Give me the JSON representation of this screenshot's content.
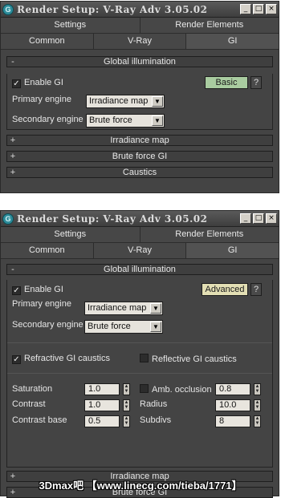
{
  "top": {
    "title": "Render Setup: V-Ray Adv 3.05.02",
    "tabs_row1": [
      "Settings",
      "Render Elements"
    ],
    "tabs_row2": [
      "Common",
      "V-Ray",
      "GI"
    ],
    "global_title": "Global illumination",
    "collapse_sign": "-",
    "enable_gi": "Enable GI",
    "mode_button": "Basic",
    "help": "?",
    "primary_label": "Primary engine",
    "primary_value": "Irradiance map",
    "secondary_label": "Secondary engine",
    "secondary_value": "Brute force",
    "rollouts": [
      "Irradiance map",
      "Brute force GI",
      "Caustics"
    ]
  },
  "bottom": {
    "title": "Render Setup: V-Ray Adv 3.05.02",
    "tabs_row1": [
      "Settings",
      "Render Elements"
    ],
    "tabs_row2": [
      "Common",
      "V-Ray",
      "GI"
    ],
    "global_title": "Global illumination",
    "collapse_sign": "-",
    "enable_gi": "Enable GI",
    "mode_button": "Advanced",
    "help": "?",
    "primary_label": "Primary engine",
    "primary_value": "Irradiance map",
    "secondary_label": "Secondary engine",
    "secondary_value": "Brute force",
    "refractive": "Refractive GI caustics",
    "reflective": "Reflective GI caustics",
    "saturation_label": "Saturation",
    "saturation": "1.0",
    "contrast_label": "Contrast",
    "contrast": "1.0",
    "contrast_base_label": "Contrast base",
    "contrast_base": "0.5",
    "amb_label": "Amb. occlusion",
    "amb": "0.8",
    "radius_label": "Radius",
    "radius": "10.0",
    "subdivs_label": "Subdivs",
    "subdivs": "8",
    "rollouts": [
      "Irradiance map",
      "Brute force GI"
    ]
  },
  "watermark": "3Dmax吧 【www.linecg.com/tieba/1771】",
  "colors": {
    "basic_button": "#a9cca0",
    "advanced_button": "#e3dfb4"
  }
}
